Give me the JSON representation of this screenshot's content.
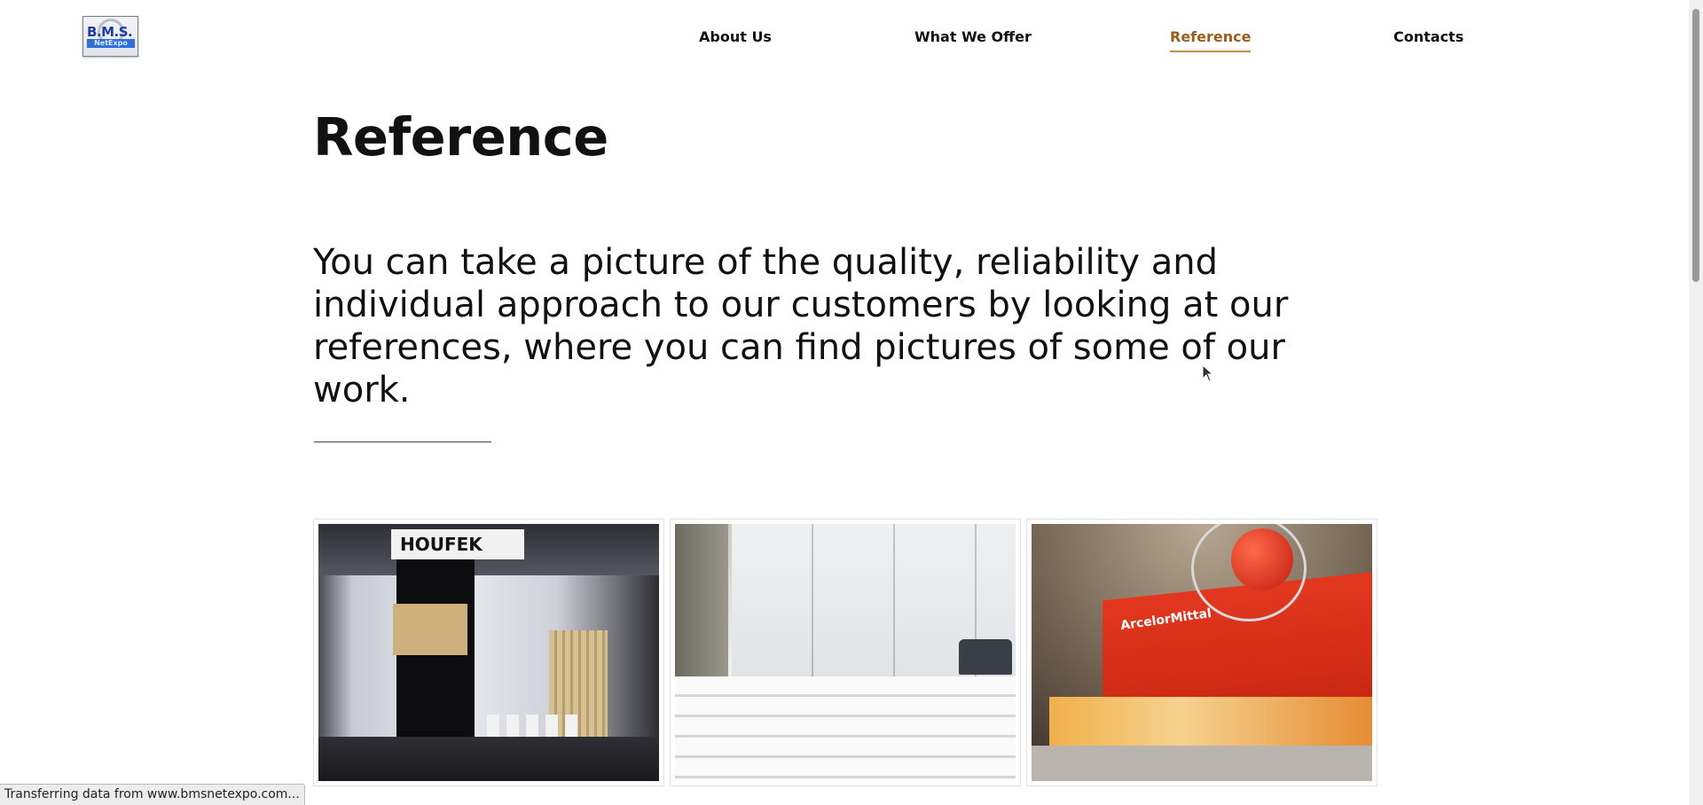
{
  "header": {
    "logo_text_top": "B.M.S.",
    "logo_text_bottom": "NetExpo",
    "nav": [
      {
        "label": "About Us"
      },
      {
        "label": "What We Offer"
      },
      {
        "label": "Reference",
        "active": true
      },
      {
        "label": "Contacts"
      }
    ]
  },
  "main": {
    "title": "Reference",
    "intro": "You can take a picture of the quality, reliability and individual approach to our customers by looking at our references, where you can find pictures of some of our work.",
    "gallery": [
      {
        "sign": "HOUFEK"
      },
      {
        "sign": ""
      },
      {
        "sign": "ArcelorMittal"
      }
    ]
  },
  "status_bar": {
    "text": "Transferring data from www.bmsnetexpo.com..."
  },
  "colors": {
    "accent": "#9a5d1f",
    "underline": "#c58b48",
    "text": "#111111",
    "background": "#ffffff"
  }
}
